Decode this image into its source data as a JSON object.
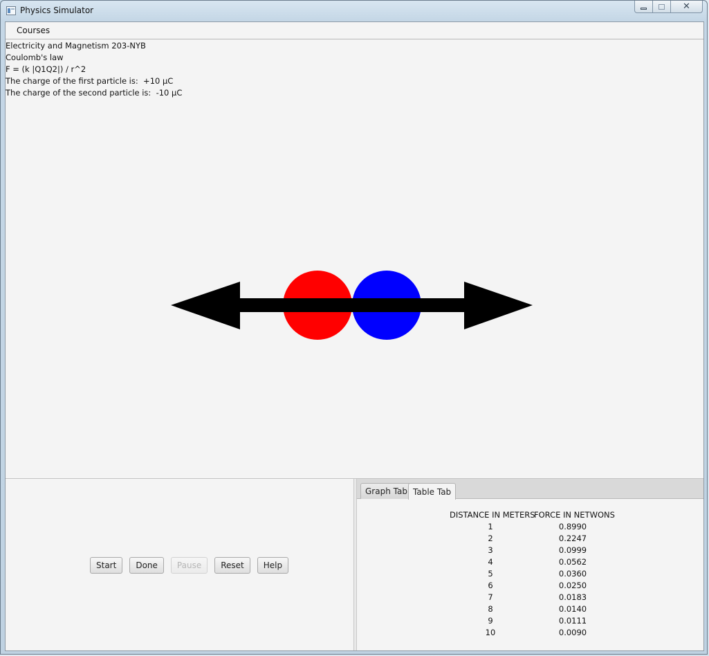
{
  "window": {
    "title": "Physics Simulator",
    "controls": {
      "minimize": "minimize",
      "maximize": "maximize",
      "close": "✕"
    }
  },
  "menu": {
    "items": [
      {
        "label": "Courses"
      }
    ]
  },
  "info": {
    "lines": [
      "Electricity and Magnetism 203-NYB",
      "Coulomb's law",
      "F = (k |Q1Q2|) / r^2",
      "The charge of the first particle is:  +10 µC",
      "The charge of the second particle is:  -10 µC"
    ]
  },
  "simulation": {
    "particles": [
      {
        "name": "first",
        "color": "#ff0000"
      },
      {
        "name": "second",
        "color": "#0000ff"
      }
    ],
    "arrow_color": "#000000"
  },
  "controls": {
    "buttons": [
      {
        "label": "Start",
        "enabled": true
      },
      {
        "label": "Done",
        "enabled": true
      },
      {
        "label": "Pause",
        "enabled": false
      },
      {
        "label": "Reset",
        "enabled": true
      },
      {
        "label": "Help",
        "enabled": true
      }
    ]
  },
  "tabs": [
    {
      "label": "Graph Tab",
      "active": false
    },
    {
      "label": "Table Tab",
      "active": true
    }
  ],
  "table": {
    "headers": {
      "distance": "DISTANCE IN METERS",
      "force": "FORCE IN NETWONS"
    },
    "rows": [
      {
        "distance": "1",
        "force": "0.8990"
      },
      {
        "distance": "2",
        "force": "0.2247"
      },
      {
        "distance": "3",
        "force": "0.0999"
      },
      {
        "distance": "4",
        "force": "0.0562"
      },
      {
        "distance": "5",
        "force": "0.0360"
      },
      {
        "distance": "6",
        "force": "0.0250"
      },
      {
        "distance": "7",
        "force": "0.0183"
      },
      {
        "distance": "8",
        "force": "0.0140"
      },
      {
        "distance": "9",
        "force": "0.0111"
      },
      {
        "distance": "10",
        "force": "0.0090"
      }
    ]
  }
}
